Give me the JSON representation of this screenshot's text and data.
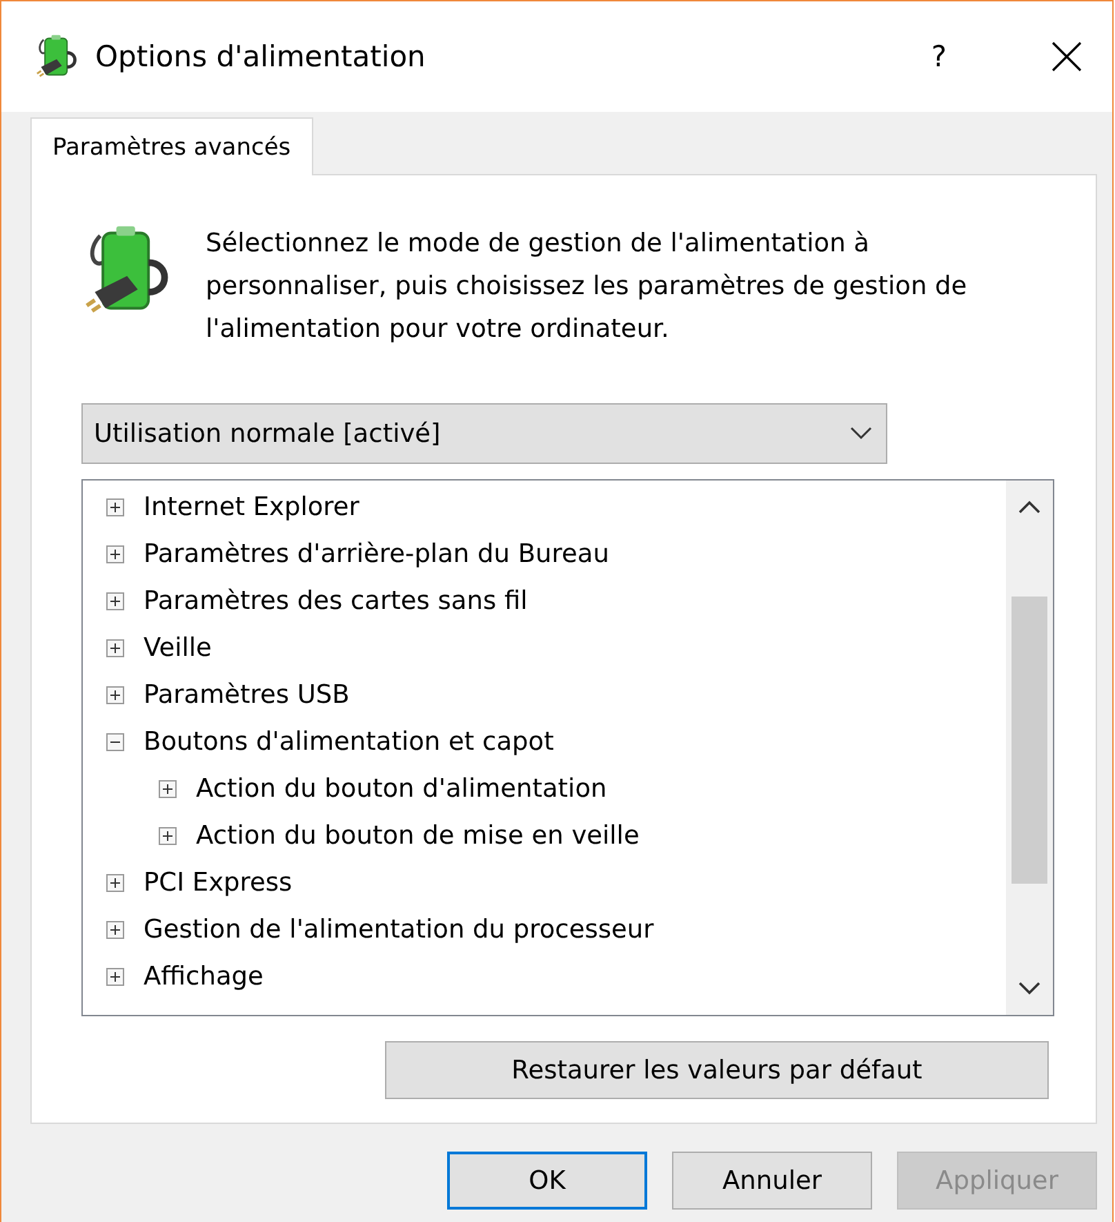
{
  "window": {
    "title": "Options d'alimentation",
    "help": "?"
  },
  "tabs": [
    {
      "label": "Paramètres avancés",
      "selected": true
    }
  ],
  "intro": "Sélectionnez le mode de gestion de l'alimentation à personnaliser, puis choisissez les paramètres de gestion de l'alimentation pour votre ordinateur.",
  "plan_dropdown": {
    "value": "Utilisation normale [activé]"
  },
  "tree": [
    {
      "label": "Internet Explorer",
      "expanded": false
    },
    {
      "label": "Paramètres d'arrière-plan du Bureau",
      "expanded": false
    },
    {
      "label": "Paramètres des cartes sans fil",
      "expanded": false
    },
    {
      "label": "Veille",
      "expanded": false
    },
    {
      "label": "Paramètres USB",
      "expanded": false
    },
    {
      "label": "Boutons d'alimentation et capot",
      "expanded": true,
      "children": [
        {
          "label": "Action du bouton d'alimentation",
          "expanded": false
        },
        {
          "label": "Action du bouton de mise en veille",
          "expanded": false
        }
      ]
    },
    {
      "label": "PCI Express",
      "expanded": false
    },
    {
      "label": "Gestion de l'alimentation du processeur",
      "expanded": false
    },
    {
      "label": "Affichage",
      "expanded": false
    }
  ],
  "restore_button": "Restaurer les valeurs par défaut",
  "buttons": [
    {
      "label": "OK",
      "focused": true,
      "disabled": false
    },
    {
      "label": "Annuler",
      "focused": false,
      "disabled": false
    },
    {
      "label": "Appliquer",
      "focused": false,
      "disabled": true
    }
  ]
}
